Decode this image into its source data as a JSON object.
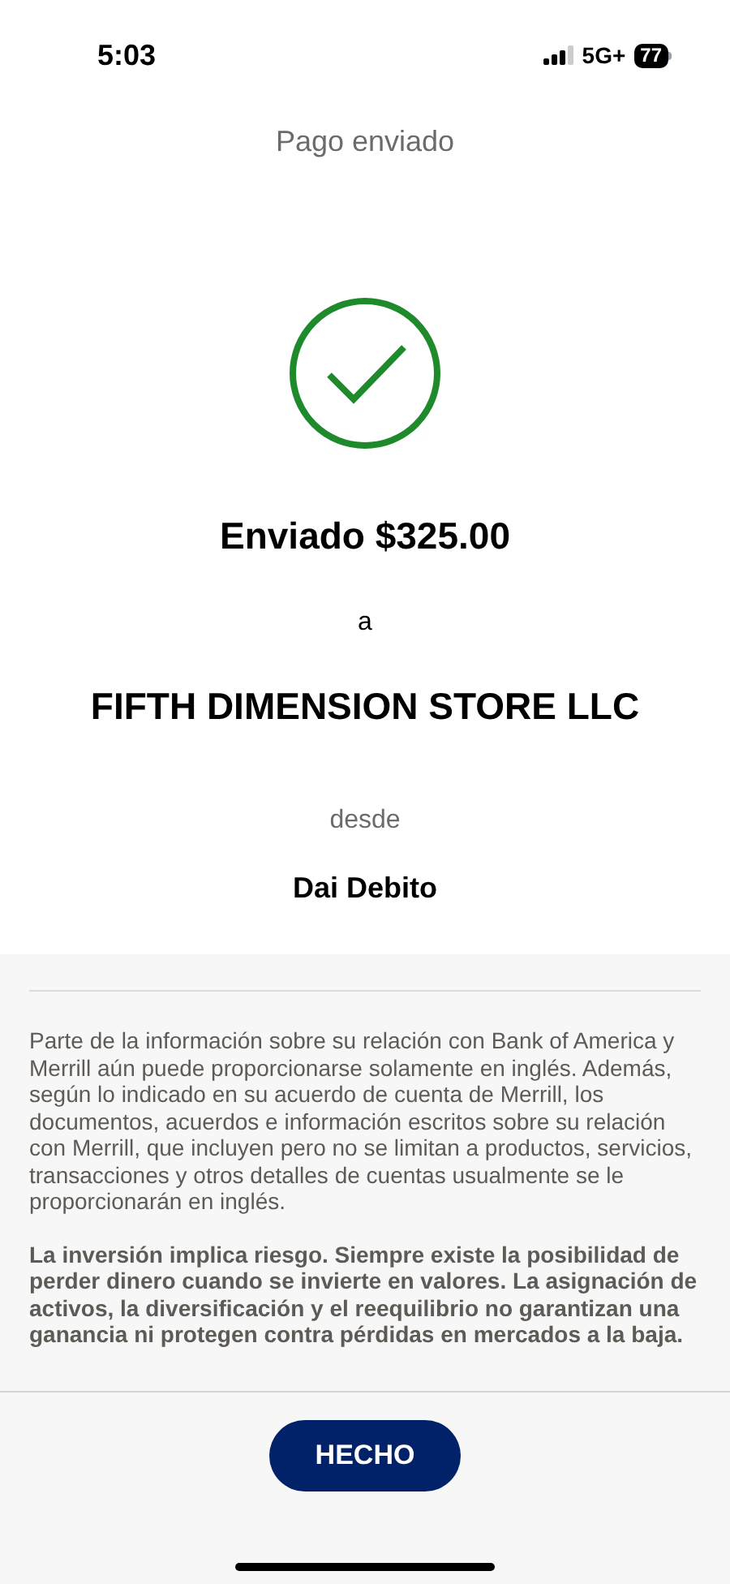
{
  "status_bar": {
    "time": "5:03",
    "network": "5G+",
    "battery": "77"
  },
  "header": {
    "title": "Pago enviado"
  },
  "confirmation": {
    "amount_line": "Enviado $325.00",
    "to_label": "a",
    "recipient": "FIFTH DIMENSION STORE LLC",
    "from_label": "desde",
    "account": "Dai Debito"
  },
  "disclosures": [
    {
      "kind": "plain",
      "text": "Parte de la información sobre su relación con Bank of America y Merrill aún puede proporcionarse solamente en inglés. Además, según lo indicado en su acuerdo de cuenta de Merrill, los documentos, acuerdos e información escritos sobre su relación con Merrill, que incluyen pero no se limitan a productos, servicios, transacciones y otros detalles de cuentas usualmente se le proporcionarán en inglés."
    },
    {
      "kind": "bold",
      "text": "La inversión implica riesgo. Siempre existe la posibilidad de perder dinero cuando se invierte en valores. La asignación de activos, la diversificación y el reequilibrio no garantizan una ganancia ni protegen contra pérdidas en mercados a la baja."
    }
  ],
  "done_button": {
    "label": "HECHO"
  }
}
